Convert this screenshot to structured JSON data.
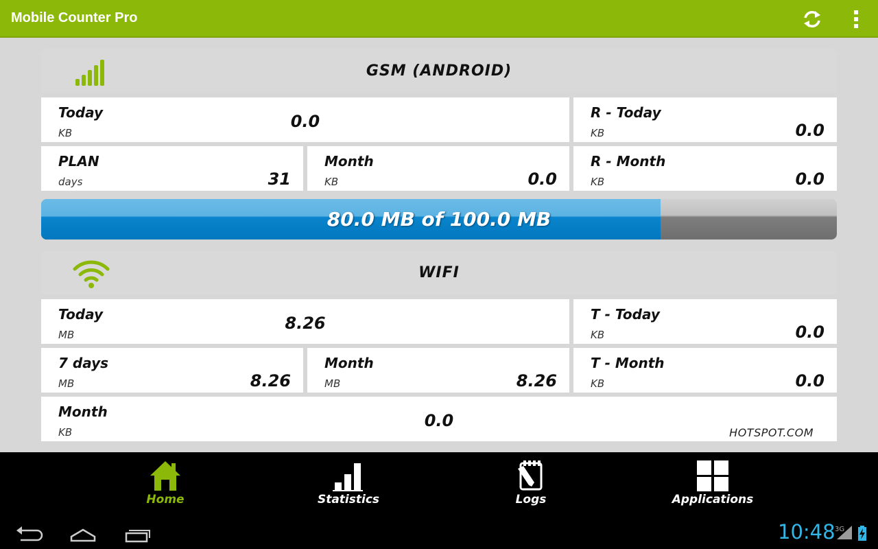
{
  "app": {
    "title": "Mobile Counter Pro"
  },
  "actions": {
    "refresh_icon": "refresh-icon",
    "overflow_icon": "overflow-menu-icon"
  },
  "gsm": {
    "title": "GSM (ANDROID)",
    "icon": "signal-bars-icon",
    "today": {
      "label": "Today",
      "unit": "KB",
      "value": "0.0"
    },
    "r_today": {
      "label": "R - Today",
      "unit": "KB",
      "value": "0.0"
    },
    "plan": {
      "label": "PLAN",
      "unit": "days",
      "value": "31"
    },
    "month": {
      "label": "Month",
      "unit": "KB",
      "value": "0.0"
    },
    "r_month": {
      "label": "R - Month",
      "unit": "KB",
      "value": "0.0"
    }
  },
  "usage": {
    "text": "80.0 MB of 100.0 MB",
    "used": 80.0,
    "total": 100.0,
    "fill_color": "#0a84cc"
  },
  "wifi": {
    "title": "WIFI",
    "icon": "wifi-icon",
    "today": {
      "label": "Today",
      "unit": "MB",
      "value": "8.26"
    },
    "t_today": {
      "label": "T - Today",
      "unit": "KB",
      "value": "0.0"
    },
    "seven_days": {
      "label": "7 days",
      "unit": "MB",
      "value": "8.26"
    },
    "month": {
      "label": "Month",
      "unit": "MB",
      "value": "8.26"
    },
    "t_month": {
      "label": "T - Month",
      "unit": "KB",
      "value": "0.0"
    }
  },
  "hotspot": {
    "label": "Month",
    "unit": "KB",
    "value": "0.0",
    "name": "HOTSPOT.COM"
  },
  "tabs": [
    {
      "label": "Home",
      "icon": "home-icon",
      "active": true
    },
    {
      "label": "Statistics",
      "icon": "bar-chart-icon",
      "active": false
    },
    {
      "label": "Logs",
      "icon": "logs-icon",
      "active": false
    },
    {
      "label": "Applications",
      "icon": "applications-grid-icon",
      "active": false
    }
  ],
  "system": {
    "time": "10:48",
    "network": "3G"
  },
  "colors": {
    "accent": "#8cb80a",
    "progress": "#0a84cc",
    "clock": "#33b5e5"
  }
}
